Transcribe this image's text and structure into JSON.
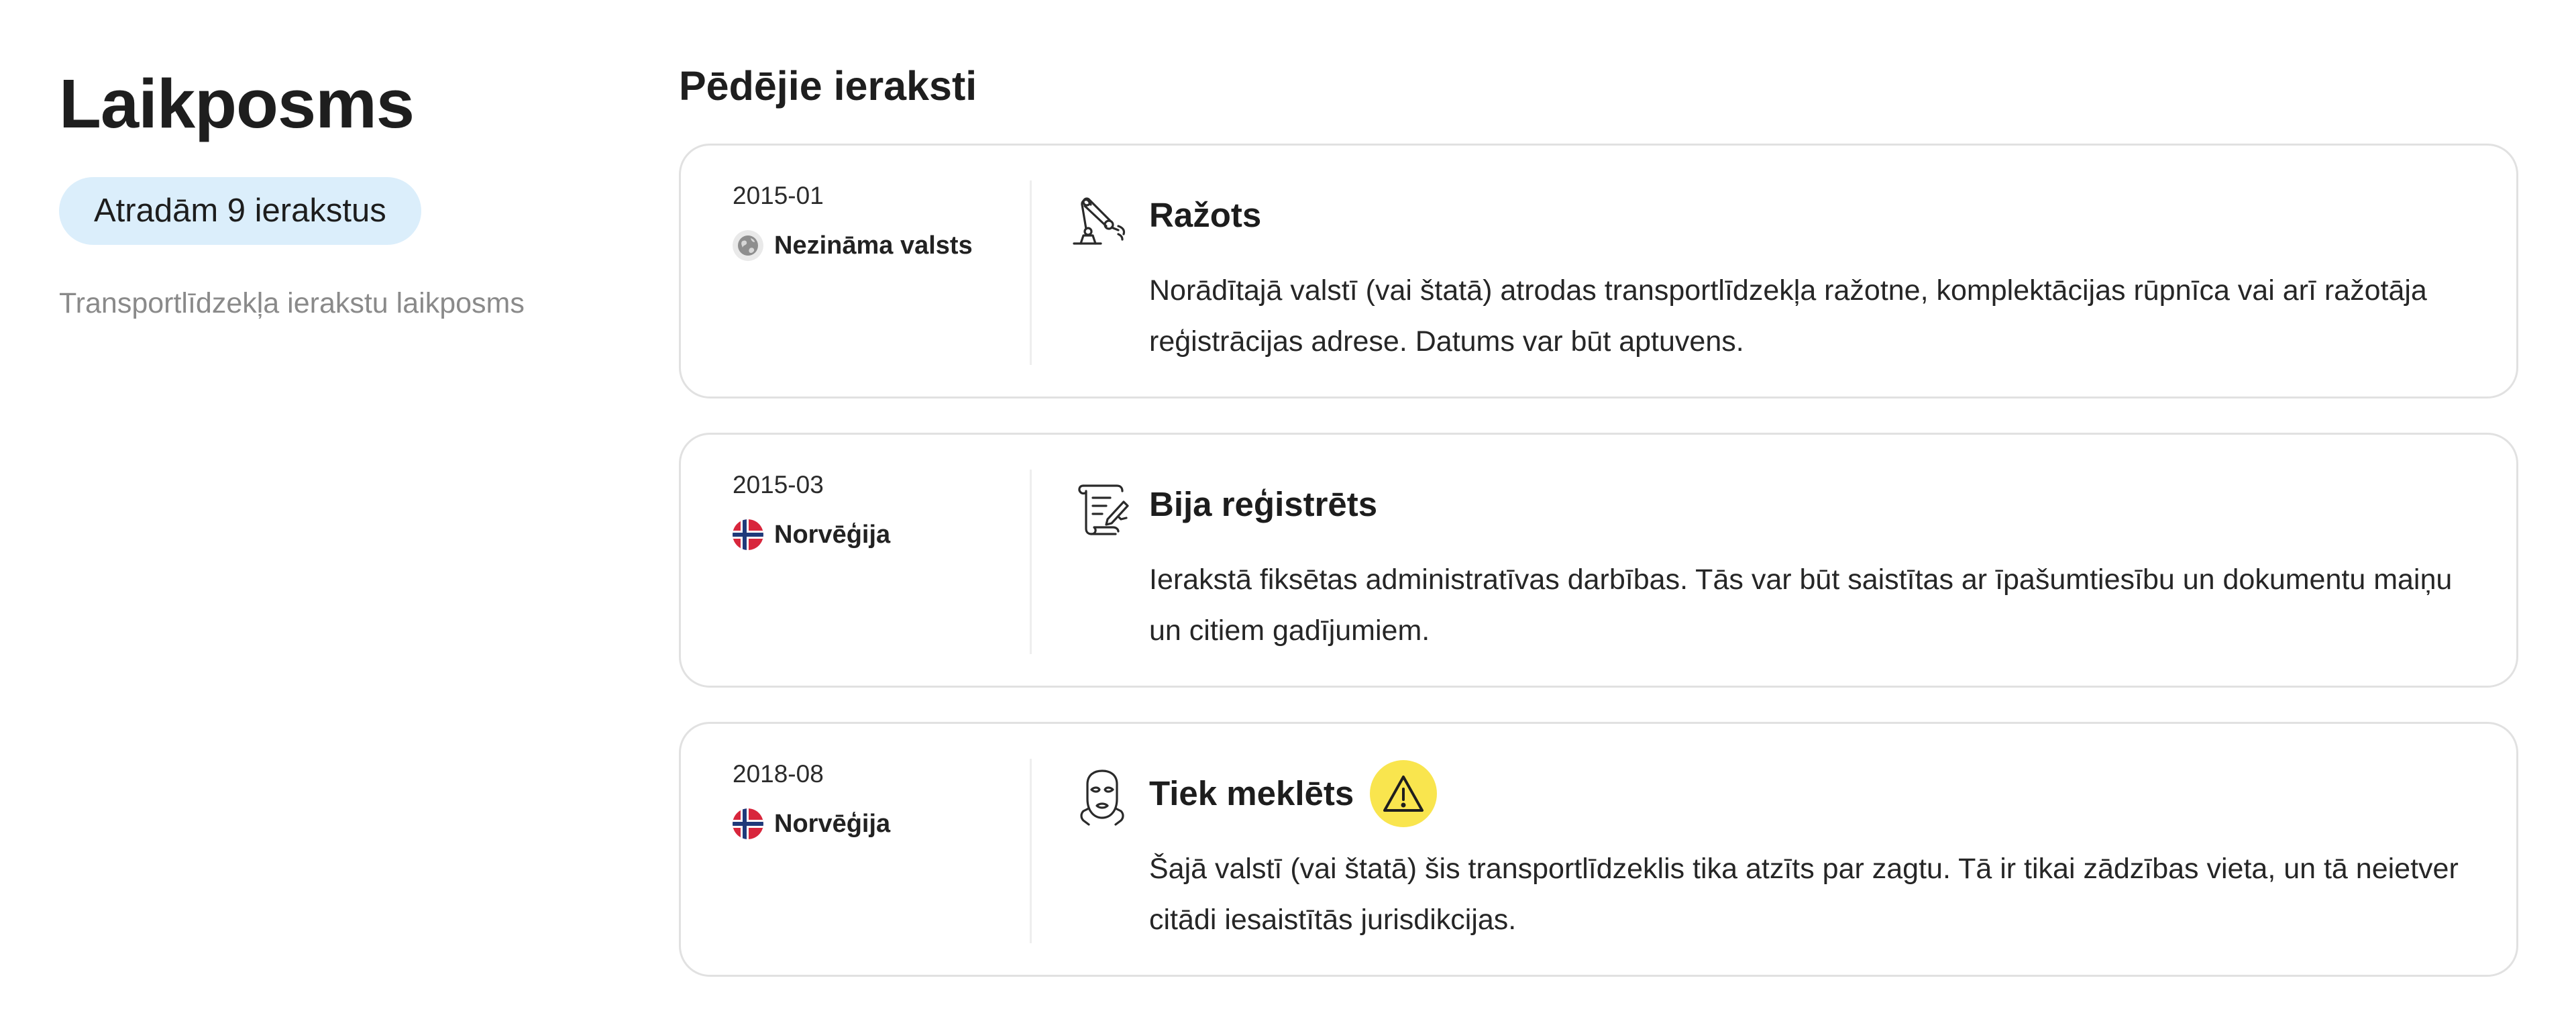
{
  "sidebar": {
    "title": "Laikposms",
    "count_badge": "Atradām 9 ierakstus",
    "subtitle": "Transportlīdzekļa ierakstu laikposms"
  },
  "main": {
    "section_title": "Pēdējie ieraksti",
    "entries": [
      {
        "date": "2015-01",
        "country": "Nezināma valsts",
        "country_icon": "globe-icon",
        "event_icon": "robot-arm-icon",
        "title": "Ražots",
        "description": "Norādītajā valstī (vai štatā) atrodas transportlīdzekļa ražotne, komplektācijas rūpnīca vai arī ražotāja reģistrācijas adrese. Datums var būt aptuvens."
      },
      {
        "date": "2015-03",
        "country": "Norvēģija",
        "country_icon": "norway-flag-icon",
        "event_icon": "document-scroll-icon",
        "title": "Bija reģistrēts",
        "description": "Ierakstā fiksētas administratīvas darbības. Tās var būt saistītas ar īpašumtiesību un dokumentu maiņu un citiem gadījumiem."
      },
      {
        "date": "2018-08",
        "country": "Norvēģija",
        "country_icon": "norway-flag-icon",
        "event_icon": "thief-mask-icon",
        "title": "Tiek meklēts",
        "badge_icon": "warning-icon",
        "description": "Šajā valstī (vai štatā) šis transportlīdzeklis tika atzīts par zagtu. Tā ir tikai zādzības vieta, un tā neietver citādi iesaistītās jurisdikcijas."
      }
    ]
  },
  "colors": {
    "badge_background": "#dbeefb",
    "warning_background": "#f9e54e",
    "card_border": "#e1e1e1",
    "subtitle_text": "#8a8a8a"
  }
}
